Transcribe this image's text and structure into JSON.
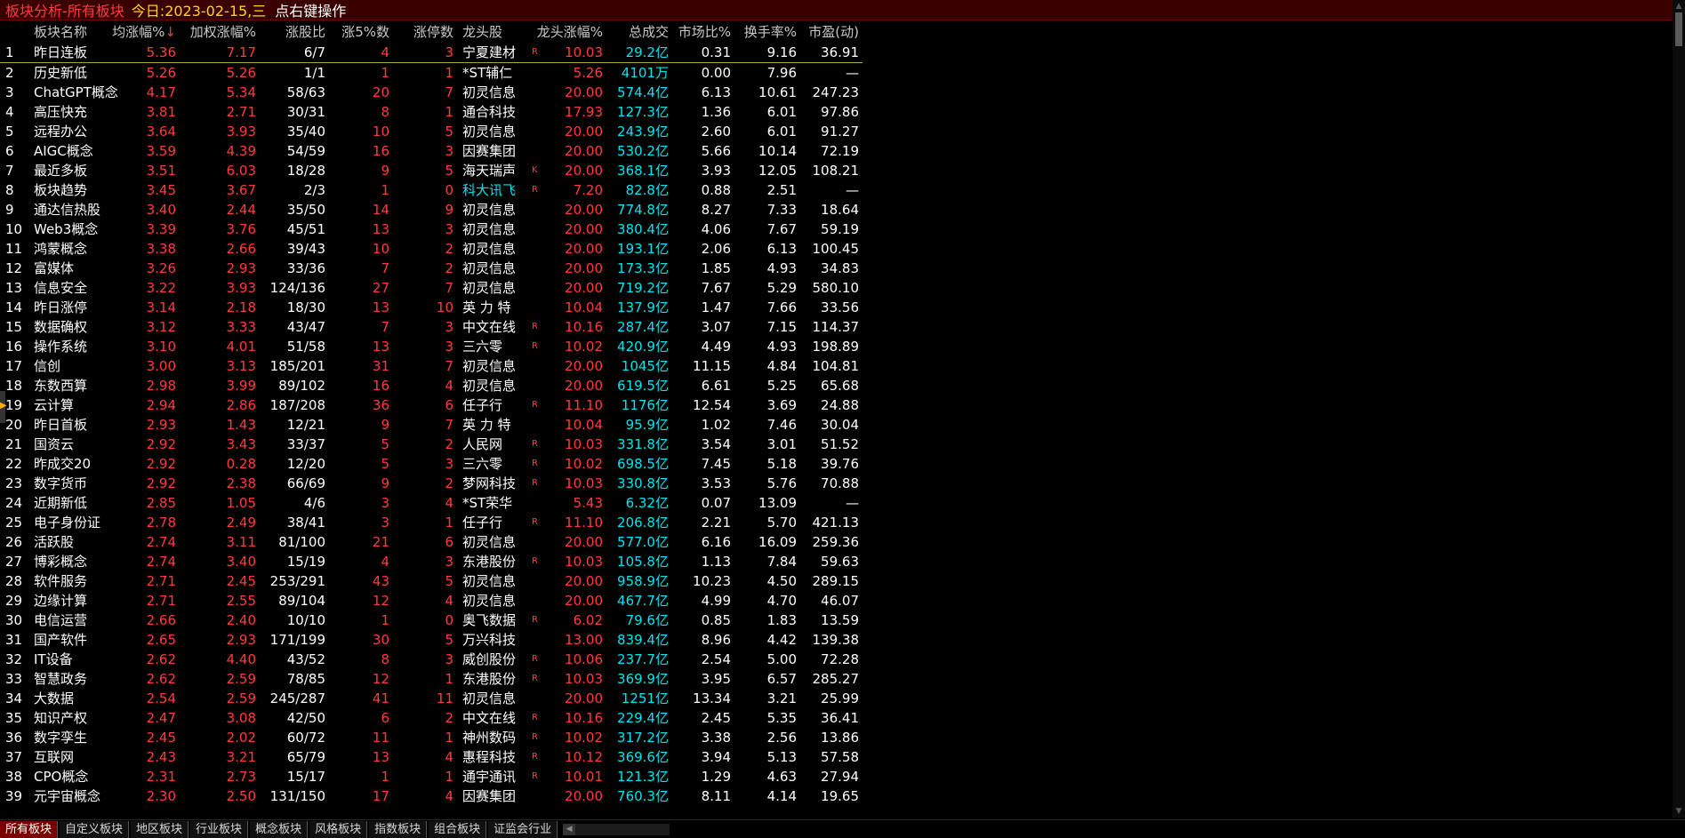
{
  "titlebar": {
    "title": "板块分析-所有板块",
    "date_label": "今日:",
    "date": "2023-02-15,三",
    "hint": "点右键操作"
  },
  "columns": {
    "name": "板块名称",
    "avg_chg": "均涨幅%",
    "sort_arrow": "↓",
    "weighted_chg": "加权涨幅%",
    "up_ratio": "涨股比",
    "up5_count": "涨5%数",
    "limit_count": "涨停数",
    "leader": "龙头股",
    "leader_chg": "龙头涨幅%",
    "turnover": "总成交",
    "market_share": "市场比%",
    "turnover_rate": "换手率%",
    "pe": "市盈(动)"
  },
  "rows": [
    {
      "idx": "1",
      "name": "昨日连板",
      "avg": "5.36",
      "wgt": "7.17",
      "ratio": "6/7",
      "up5": "4",
      "lim": "3",
      "lead": "宁夏建材",
      "flag": "R",
      "lchg": "10.03",
      "turn": "29.2",
      "unit": "亿",
      "mkt": "0.31",
      "hs": "9.16",
      "pe": "36.91"
    },
    {
      "idx": "2",
      "name": "历史新低",
      "avg": "5.26",
      "wgt": "5.26",
      "ratio": "1/1",
      "up5": "1",
      "lim": "1",
      "lead": "*ST辅仁",
      "flag": "",
      "lchg": "5.26",
      "turn": "4101",
      "unit": "万",
      "mkt": "0.00",
      "hs": "7.96",
      "pe": "—"
    },
    {
      "idx": "3",
      "name": "ChatGPT概念",
      "avg": "4.17",
      "wgt": "5.34",
      "ratio": "58/63",
      "up5": "20",
      "lim": "7",
      "lead": "初灵信息",
      "flag": "",
      "lchg": "20.00",
      "turn": "574.4",
      "unit": "亿",
      "mkt": "6.13",
      "hs": "10.61",
      "pe": "247.23"
    },
    {
      "idx": "4",
      "name": "高压快充",
      "avg": "3.81",
      "wgt": "2.71",
      "ratio": "30/31",
      "up5": "8",
      "lim": "1",
      "lead": "通合科技",
      "flag": "",
      "lchg": "17.93",
      "turn": "127.3",
      "unit": "亿",
      "mkt": "1.36",
      "hs": "6.01",
      "pe": "97.86"
    },
    {
      "idx": "5",
      "name": "远程办公",
      "avg": "3.64",
      "wgt": "3.93",
      "ratio": "35/40",
      "up5": "10",
      "lim": "5",
      "lead": "初灵信息",
      "flag": "",
      "lchg": "20.00",
      "turn": "243.9",
      "unit": "亿",
      "mkt": "2.60",
      "hs": "6.01",
      "pe": "91.27"
    },
    {
      "idx": "6",
      "name": "AIGC概念",
      "avg": "3.59",
      "wgt": "4.39",
      "ratio": "54/59",
      "up5": "16",
      "lim": "3",
      "lead": "因赛集团",
      "flag": "",
      "lchg": "20.00",
      "turn": "530.2",
      "unit": "亿",
      "mkt": "5.66",
      "hs": "10.14",
      "pe": "72.19"
    },
    {
      "idx": "7",
      "name": "最近多板",
      "avg": "3.51",
      "wgt": "6.03",
      "ratio": "18/28",
      "up5": "9",
      "lim": "5",
      "lead": "海天瑞声",
      "flag": "K",
      "lchg": "20.00",
      "turn": "368.1",
      "unit": "亿",
      "mkt": "3.93",
      "hs": "12.05",
      "pe": "108.21"
    },
    {
      "idx": "8",
      "name": "板块趋势",
      "avg": "3.45",
      "wgt": "3.67",
      "ratio": "2/3",
      "up5": "1",
      "lim": "0",
      "lead": "科大讯飞",
      "flag": "R",
      "lchg": "7.20",
      "turn": "82.8",
      "unit": "亿",
      "mkt": "0.88",
      "hs": "2.51",
      "pe": "—",
      "lead_cyan": true
    },
    {
      "idx": "9",
      "name": "通达信热股",
      "avg": "3.40",
      "wgt": "2.44",
      "ratio": "35/50",
      "up5": "14",
      "lim": "9",
      "lead": "初灵信息",
      "flag": "",
      "lchg": "20.00",
      "turn": "774.8",
      "unit": "亿",
      "mkt": "8.27",
      "hs": "7.33",
      "pe": "18.64"
    },
    {
      "idx": "10",
      "name": "Web3概念",
      "avg": "3.39",
      "wgt": "3.76",
      "ratio": "45/51",
      "up5": "13",
      "lim": "3",
      "lead": "初灵信息",
      "flag": "",
      "lchg": "20.00",
      "turn": "380.4",
      "unit": "亿",
      "mkt": "4.06",
      "hs": "7.67",
      "pe": "59.19"
    },
    {
      "idx": "11",
      "name": "鸿蒙概念",
      "avg": "3.38",
      "wgt": "2.66",
      "ratio": "39/43",
      "up5": "10",
      "lim": "2",
      "lead": "初灵信息",
      "flag": "",
      "lchg": "20.00",
      "turn": "193.1",
      "unit": "亿",
      "mkt": "2.06",
      "hs": "6.13",
      "pe": "100.45"
    },
    {
      "idx": "12",
      "name": "富媒体",
      "avg": "3.26",
      "wgt": "2.93",
      "ratio": "33/36",
      "up5": "7",
      "lim": "2",
      "lead": "初灵信息",
      "flag": "",
      "lchg": "20.00",
      "turn": "173.3",
      "unit": "亿",
      "mkt": "1.85",
      "hs": "4.93",
      "pe": "34.83"
    },
    {
      "idx": "13",
      "name": "信息安全",
      "avg": "3.22",
      "wgt": "3.93",
      "ratio": "124/136",
      "up5": "27",
      "lim": "7",
      "lead": "初灵信息",
      "flag": "",
      "lchg": "20.00",
      "turn": "719.2",
      "unit": "亿",
      "mkt": "7.67",
      "hs": "5.29",
      "pe": "580.10"
    },
    {
      "idx": "14",
      "name": "昨日涨停",
      "avg": "3.14",
      "wgt": "2.18",
      "ratio": "18/30",
      "up5": "13",
      "lim": "10",
      "lead": "英 力 特",
      "flag": "",
      "lchg": "10.04",
      "turn": "137.9",
      "unit": "亿",
      "mkt": "1.47",
      "hs": "7.66",
      "pe": "33.56"
    },
    {
      "idx": "15",
      "name": "数据确权",
      "avg": "3.12",
      "wgt": "3.33",
      "ratio": "43/47",
      "up5": "7",
      "lim": "3",
      "lead": "中文在线",
      "flag": "R",
      "lchg": "10.16",
      "turn": "287.4",
      "unit": "亿",
      "mkt": "3.07",
      "hs": "7.15",
      "pe": "114.37"
    },
    {
      "idx": "16",
      "name": "操作系统",
      "avg": "3.10",
      "wgt": "4.01",
      "ratio": "51/58",
      "up5": "13",
      "lim": "3",
      "lead": "三六零",
      "flag": "R",
      "lchg": "10.02",
      "turn": "420.9",
      "unit": "亿",
      "mkt": "4.49",
      "hs": "4.93",
      "pe": "198.89"
    },
    {
      "idx": "17",
      "name": "信创",
      "avg": "3.00",
      "wgt": "3.13",
      "ratio": "185/201",
      "up5": "31",
      "lim": "7",
      "lead": "初灵信息",
      "flag": "",
      "lchg": "20.00",
      "turn": "1045",
      "unit": "亿",
      "mkt": "11.15",
      "hs": "4.84",
      "pe": "104.81"
    },
    {
      "idx": "18",
      "name": "东数西算",
      "avg": "2.98",
      "wgt": "3.99",
      "ratio": "89/102",
      "up5": "16",
      "lim": "4",
      "lead": "初灵信息",
      "flag": "",
      "lchg": "20.00",
      "turn": "619.5",
      "unit": "亿",
      "mkt": "6.61",
      "hs": "5.25",
      "pe": "65.68"
    },
    {
      "idx": "19",
      "name": "云计算",
      "avg": "2.94",
      "wgt": "2.86",
      "ratio": "187/208",
      "up5": "36",
      "lim": "6",
      "lead": "任子行",
      "flag": "R",
      "lchg": "11.10",
      "turn": "1176",
      "unit": "亿",
      "mkt": "12.54",
      "hs": "3.69",
      "pe": "24.88"
    },
    {
      "idx": "20",
      "name": "昨日首板",
      "avg": "2.93",
      "wgt": "1.43",
      "ratio": "12/21",
      "up5": "9",
      "lim": "7",
      "lead": "英 力 特",
      "flag": "",
      "lchg": "10.04",
      "turn": "95.9",
      "unit": "亿",
      "mkt": "1.02",
      "hs": "7.46",
      "pe": "30.04"
    },
    {
      "idx": "21",
      "name": "国资云",
      "avg": "2.92",
      "wgt": "3.43",
      "ratio": "33/37",
      "up5": "5",
      "lim": "2",
      "lead": "人民网",
      "flag": "R",
      "lchg": "10.03",
      "turn": "331.8",
      "unit": "亿",
      "mkt": "3.54",
      "hs": "3.01",
      "pe": "51.52"
    },
    {
      "idx": "22",
      "name": "昨成交20",
      "avg": "2.92",
      "wgt": "0.28",
      "ratio": "12/20",
      "up5": "5",
      "lim": "3",
      "lead": "三六零",
      "flag": "R",
      "lchg": "10.02",
      "turn": "698.5",
      "unit": "亿",
      "mkt": "7.45",
      "hs": "5.18",
      "pe": "39.76"
    },
    {
      "idx": "23",
      "name": "数字货币",
      "avg": "2.92",
      "wgt": "2.38",
      "ratio": "66/69",
      "up5": "9",
      "lim": "2",
      "lead": "梦网科技",
      "flag": "R",
      "lchg": "10.03",
      "turn": "330.8",
      "unit": "亿",
      "mkt": "3.53",
      "hs": "5.76",
      "pe": "70.88"
    },
    {
      "idx": "24",
      "name": "近期新低",
      "avg": "2.85",
      "wgt": "1.05",
      "ratio": "4/6",
      "up5": "3",
      "lim": "4",
      "lead": "*ST荣华",
      "flag": "",
      "lchg": "5.43",
      "turn": "6.32",
      "unit": "亿",
      "mkt": "0.07",
      "hs": "13.09",
      "pe": "—"
    },
    {
      "idx": "25",
      "name": "电子身份证",
      "avg": "2.78",
      "wgt": "2.49",
      "ratio": "38/41",
      "up5": "3",
      "lim": "1",
      "lead": "任子行",
      "flag": "R",
      "lchg": "11.10",
      "turn": "206.8",
      "unit": "亿",
      "mkt": "2.21",
      "hs": "5.70",
      "pe": "421.13"
    },
    {
      "idx": "26",
      "name": "活跃股",
      "avg": "2.74",
      "wgt": "3.11",
      "ratio": "81/100",
      "up5": "21",
      "lim": "6",
      "lead": "初灵信息",
      "flag": "",
      "lchg": "20.00",
      "turn": "577.0",
      "unit": "亿",
      "mkt": "6.16",
      "hs": "16.09",
      "pe": "259.36"
    },
    {
      "idx": "27",
      "name": "博彩概念",
      "avg": "2.74",
      "wgt": "3.40",
      "ratio": "15/19",
      "up5": "4",
      "lim": "3",
      "lead": "东港股份",
      "flag": "R",
      "lchg": "10.03",
      "turn": "105.8",
      "unit": "亿",
      "mkt": "1.13",
      "hs": "7.84",
      "pe": "59.63"
    },
    {
      "idx": "28",
      "name": "软件服务",
      "avg": "2.71",
      "wgt": "2.45",
      "ratio": "253/291",
      "up5": "43",
      "lim": "5",
      "lead": "初灵信息",
      "flag": "",
      "lchg": "20.00",
      "turn": "958.9",
      "unit": "亿",
      "mkt": "10.23",
      "hs": "4.50",
      "pe": "289.15"
    },
    {
      "idx": "29",
      "name": "边缘计算",
      "avg": "2.71",
      "wgt": "2.55",
      "ratio": "89/104",
      "up5": "12",
      "lim": "4",
      "lead": "初灵信息",
      "flag": "",
      "lchg": "20.00",
      "turn": "467.7",
      "unit": "亿",
      "mkt": "4.99",
      "hs": "4.70",
      "pe": "46.07"
    },
    {
      "idx": "30",
      "name": "电信运营",
      "avg": "2.66",
      "wgt": "2.40",
      "ratio": "10/10",
      "up5": "1",
      "lim": "0",
      "lead": "奥飞数据",
      "flag": "R",
      "lchg": "6.02",
      "turn": "79.6",
      "unit": "亿",
      "mkt": "0.85",
      "hs": "1.83",
      "pe": "13.59"
    },
    {
      "idx": "31",
      "name": "国产软件",
      "avg": "2.65",
      "wgt": "2.93",
      "ratio": "171/199",
      "up5": "30",
      "lim": "5",
      "lead": "万兴科技",
      "flag": "",
      "lchg": "13.00",
      "turn": "839.4",
      "unit": "亿",
      "mkt": "8.96",
      "hs": "4.42",
      "pe": "139.38"
    },
    {
      "idx": "32",
      "name": "IT设备",
      "avg": "2.62",
      "wgt": "4.40",
      "ratio": "43/52",
      "up5": "8",
      "lim": "3",
      "lead": "威创股份",
      "flag": "R",
      "lchg": "10.06",
      "turn": "237.7",
      "unit": "亿",
      "mkt": "2.54",
      "hs": "5.00",
      "pe": "72.28"
    },
    {
      "idx": "33",
      "name": "智慧政务",
      "avg": "2.62",
      "wgt": "2.59",
      "ratio": "78/85",
      "up5": "12",
      "lim": "1",
      "lead": "东港股份",
      "flag": "R",
      "lchg": "10.03",
      "turn": "369.9",
      "unit": "亿",
      "mkt": "3.95",
      "hs": "6.57",
      "pe": "285.27"
    },
    {
      "idx": "34",
      "name": "大数据",
      "avg": "2.54",
      "wgt": "2.59",
      "ratio": "245/287",
      "up5": "41",
      "lim": "11",
      "lead": "初灵信息",
      "flag": "",
      "lchg": "20.00",
      "turn": "1251",
      "unit": "亿",
      "mkt": "13.34",
      "hs": "3.21",
      "pe": "25.99"
    },
    {
      "idx": "35",
      "name": "知识产权",
      "avg": "2.47",
      "wgt": "3.08",
      "ratio": "42/50",
      "up5": "6",
      "lim": "2",
      "lead": "中文在线",
      "flag": "R",
      "lchg": "10.16",
      "turn": "229.4",
      "unit": "亿",
      "mkt": "2.45",
      "hs": "5.35",
      "pe": "36.41"
    },
    {
      "idx": "36",
      "name": "数字孪生",
      "avg": "2.45",
      "wgt": "2.02",
      "ratio": "60/72",
      "up5": "11",
      "lim": "1",
      "lead": "神州数码",
      "flag": "R",
      "lchg": "10.02",
      "turn": "317.2",
      "unit": "亿",
      "mkt": "3.38",
      "hs": "2.56",
      "pe": "13.86"
    },
    {
      "idx": "37",
      "name": "互联网",
      "avg": "2.43",
      "wgt": "3.21",
      "ratio": "65/79",
      "up5": "13",
      "lim": "4",
      "lead": "惠程科技",
      "flag": "R",
      "lchg": "10.12",
      "turn": "369.6",
      "unit": "亿",
      "mkt": "3.94",
      "hs": "5.13",
      "pe": "57.58"
    },
    {
      "idx": "38",
      "name": "CPO概念",
      "avg": "2.31",
      "wgt": "2.73",
      "ratio": "15/17",
      "up5": "1",
      "lim": "1",
      "lead": "通宇通讯",
      "flag": "R",
      "lchg": "10.01",
      "turn": "121.3",
      "unit": "亿",
      "mkt": "1.29",
      "hs": "4.63",
      "pe": "27.94"
    },
    {
      "idx": "39",
      "name": "元宇宙概念",
      "avg": "2.30",
      "wgt": "2.50",
      "ratio": "131/150",
      "up5": "17",
      "lim": "4",
      "lead": "因赛集团",
      "flag": "",
      "lchg": "20.00",
      "turn": "760.3",
      "unit": "亿",
      "mkt": "8.11",
      "hs": "4.14",
      "pe": "19.65"
    }
  ],
  "tabs": [
    "所有板块",
    "自定义板块",
    "地区板块",
    "行业板块",
    "概念板块",
    "风格板块",
    "指数板块",
    "组合板块",
    "证监会行业"
  ],
  "active_tab": "所有板块",
  "colors": {
    "up": "#ff3c3c",
    "neutral": "#ffffff",
    "turnover": "#00e5ee",
    "date": "#ffd700",
    "active_tab": "#7a0000"
  },
  "icons": {
    "scroll_up": "scroll-up-arrow-icon",
    "scroll_down": "scroll-down-arrow-icon",
    "tab_scroll_left": "tab-scroll-left-icon",
    "left_marker": "left-marker-arrow-icon"
  }
}
